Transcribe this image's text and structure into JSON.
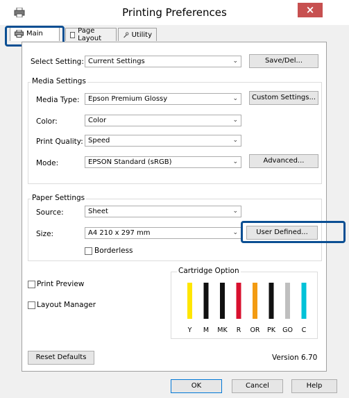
{
  "window": {
    "title": "Printing Preferences",
    "close_glyph": "×"
  },
  "tabs": [
    {
      "label": "Main",
      "icon": "printer-icon"
    },
    {
      "label": "Page Layout",
      "icon": "page-icon"
    },
    {
      "label": "Utility",
      "icon": "wrench-icon"
    }
  ],
  "select_setting": {
    "label": "Select Setting:",
    "value": "Current Settings",
    "button": "Save/Del..."
  },
  "media": {
    "title": "Media Settings",
    "media_type_label": "Media Type:",
    "media_type_value": "Epson Premium Glossy",
    "custom_button": "Custom Settings...",
    "color_label": "Color:",
    "color_value": "Color",
    "quality_label": "Print Quality:",
    "quality_value": "Speed",
    "mode_label": "Mode:",
    "mode_value": "EPSON Standard (sRGB)",
    "advanced_button": "Advanced..."
  },
  "paper": {
    "title": "Paper Settings",
    "source_label": "Source:",
    "source_value": "Sheet",
    "size_label": "Size:",
    "size_value": "A4 210 x 297 mm",
    "user_defined_button": "User Defined...",
    "borderless_label": "Borderless"
  },
  "options": {
    "print_preview": "Print Preview",
    "layout_manager": "Layout Manager"
  },
  "cartridge": {
    "title": "Cartridge Option",
    "inks": [
      {
        "code": "Y",
        "color": "#ffe600"
      },
      {
        "code": "M",
        "color": "#111111"
      },
      {
        "code": "MK",
        "color": "#111111"
      },
      {
        "code": "R",
        "color": "#d8102e"
      },
      {
        "code": "OR",
        "color": "#f39b12"
      },
      {
        "code": "PK",
        "color": "#111111"
      },
      {
        "code": "GO",
        "color": "#bfbfbf"
      },
      {
        "code": "C",
        "color": "#00c2d8"
      }
    ]
  },
  "footer": {
    "reset": "Reset Defaults",
    "version": "Version 6.70",
    "ok": "OK",
    "cancel": "Cancel",
    "help": "Help"
  },
  "colors": {
    "highlight": "#0b4f93",
    "close": "#c75050"
  }
}
